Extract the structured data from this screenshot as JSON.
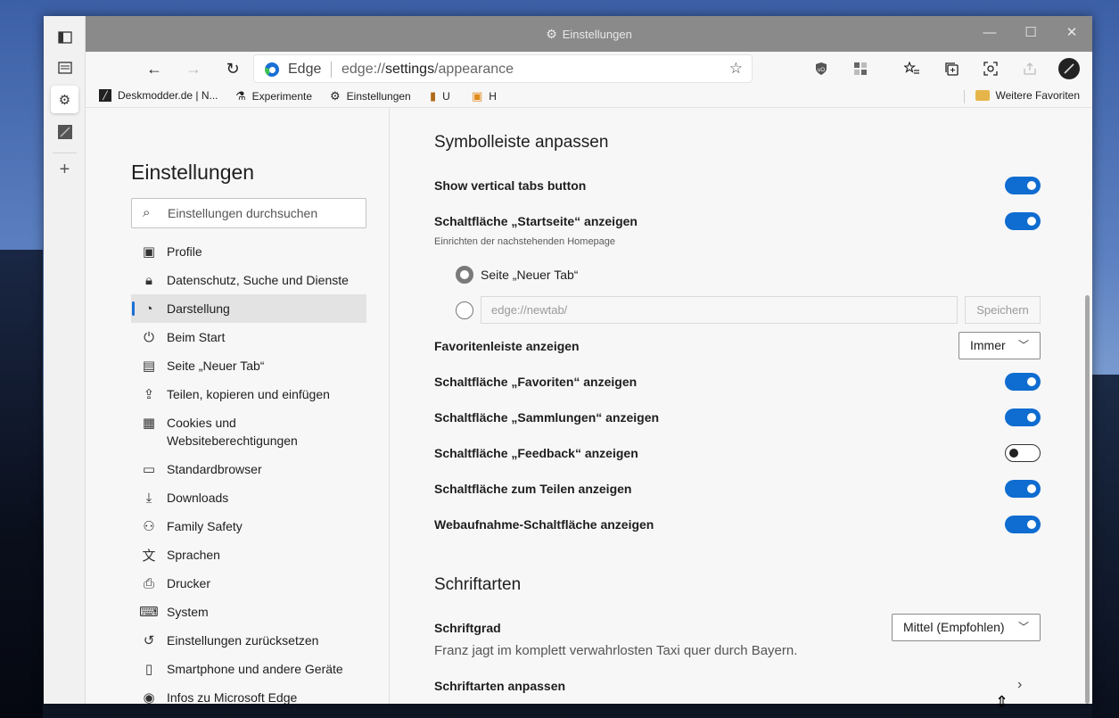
{
  "window": {
    "title": "Einstellungen",
    "controls": {
      "minimize": "—",
      "maximize": "☐",
      "close": "✕"
    }
  },
  "vertical_tabs": {
    "icons": [
      "tab-actions-icon",
      "tab-page-icon",
      "settings-gear-icon",
      "deskmodder-tab-icon",
      "new-tab-plus-icon"
    ]
  },
  "toolbar": {
    "address": {
      "site_label": "Edge",
      "url_scheme": "edge://",
      "url_host": "settings",
      "url_path": "/appearance"
    }
  },
  "favorites_bar": {
    "items": [
      {
        "label": "Deskmodder.de | N...",
        "icon": "deskmodder-icon"
      },
      {
        "label": "Experimente",
        "icon": "flask-icon"
      },
      {
        "label": "Einstellungen",
        "icon": "gear-icon"
      },
      {
        "label": "U",
        "icon": "extension-icon"
      },
      {
        "label": "H",
        "icon": "extension-icon"
      }
    ],
    "other_favorites": "Weitere Favoriten"
  },
  "settings_nav": {
    "title": "Einstellungen",
    "search_placeholder": "Einstellungen durchsuchen",
    "items": [
      {
        "label": "Profile",
        "icon": "profile-icon"
      },
      {
        "label": "Datenschutz, Suche und Dienste",
        "icon": "lock-icon"
      },
      {
        "label": "Darstellung",
        "icon": "palette-icon",
        "active": true
      },
      {
        "label": "Beim Start",
        "icon": "power-icon"
      },
      {
        "label": "Seite „Neuer Tab“",
        "icon": "newtab-page-icon"
      },
      {
        "label": "Teilen, kopieren und einfügen",
        "icon": "share-icon"
      },
      {
        "label": "Cookies und Websiteberechtigungen",
        "line1": "Cookies und",
        "line2": "Websiteberechtigungen",
        "icon": "cookies-icon"
      },
      {
        "label": "Standardbrowser",
        "icon": "browser-icon"
      },
      {
        "label": "Downloads",
        "icon": "download-icon"
      },
      {
        "label": "Family Safety",
        "icon": "family-icon"
      },
      {
        "label": "Sprachen",
        "icon": "language-icon"
      },
      {
        "label": "Drucker",
        "icon": "printer-icon"
      },
      {
        "label": "System",
        "icon": "laptop-icon"
      },
      {
        "label": "Einstellungen zurücksetzen",
        "icon": "reset-icon"
      },
      {
        "label": "Smartphone und andere Geräte",
        "icon": "phone-icon"
      },
      {
        "label": "Infos zu Microsoft Edge",
        "icon": "edge-icon"
      }
    ]
  },
  "toolbar_section": {
    "title": "Symbolleiste anpassen",
    "vertical_tabs_button": {
      "label": "Show vertical tabs button",
      "on": true
    },
    "home_button": {
      "label": "Schaltfläche „Startseite“ anzeigen",
      "sub": "Einrichten der nachstehenden Homepage",
      "on": true
    },
    "home_options": {
      "new_tab_label": "Seite „Neuer Tab“",
      "url_placeholder": "edge://newtab/",
      "save_label": "Speichern"
    },
    "favorites_bar": {
      "label": "Favoritenleiste anzeigen",
      "value": "Immer"
    },
    "favorites_button": {
      "label": "Schaltfläche „Favoriten“ anzeigen",
      "on": true
    },
    "collections_button": {
      "label": "Schaltfläche „Sammlungen“ anzeigen",
      "on": true
    },
    "feedback_button": {
      "label": "Schaltfläche „Feedback“ anzeigen",
      "on": false
    },
    "share_button": {
      "label": "Schaltfläche zum Teilen anzeigen",
      "on": true
    },
    "webcapture_button": {
      "label": "Webaufnahme-Schaltfläche anzeigen",
      "on": true
    }
  },
  "fonts_section": {
    "title": "Schriftarten",
    "font_size": {
      "label": "Schriftgrad",
      "value": "Mittel (Empfohlen)"
    },
    "sample": "Franz jagt im komplett verwahrlosten Taxi quer durch Bayern.",
    "customize_label": "Schriftarten anpassen"
  },
  "colors": {
    "accent": "#0f6cd0",
    "titlebar": "#8a8a8a"
  }
}
